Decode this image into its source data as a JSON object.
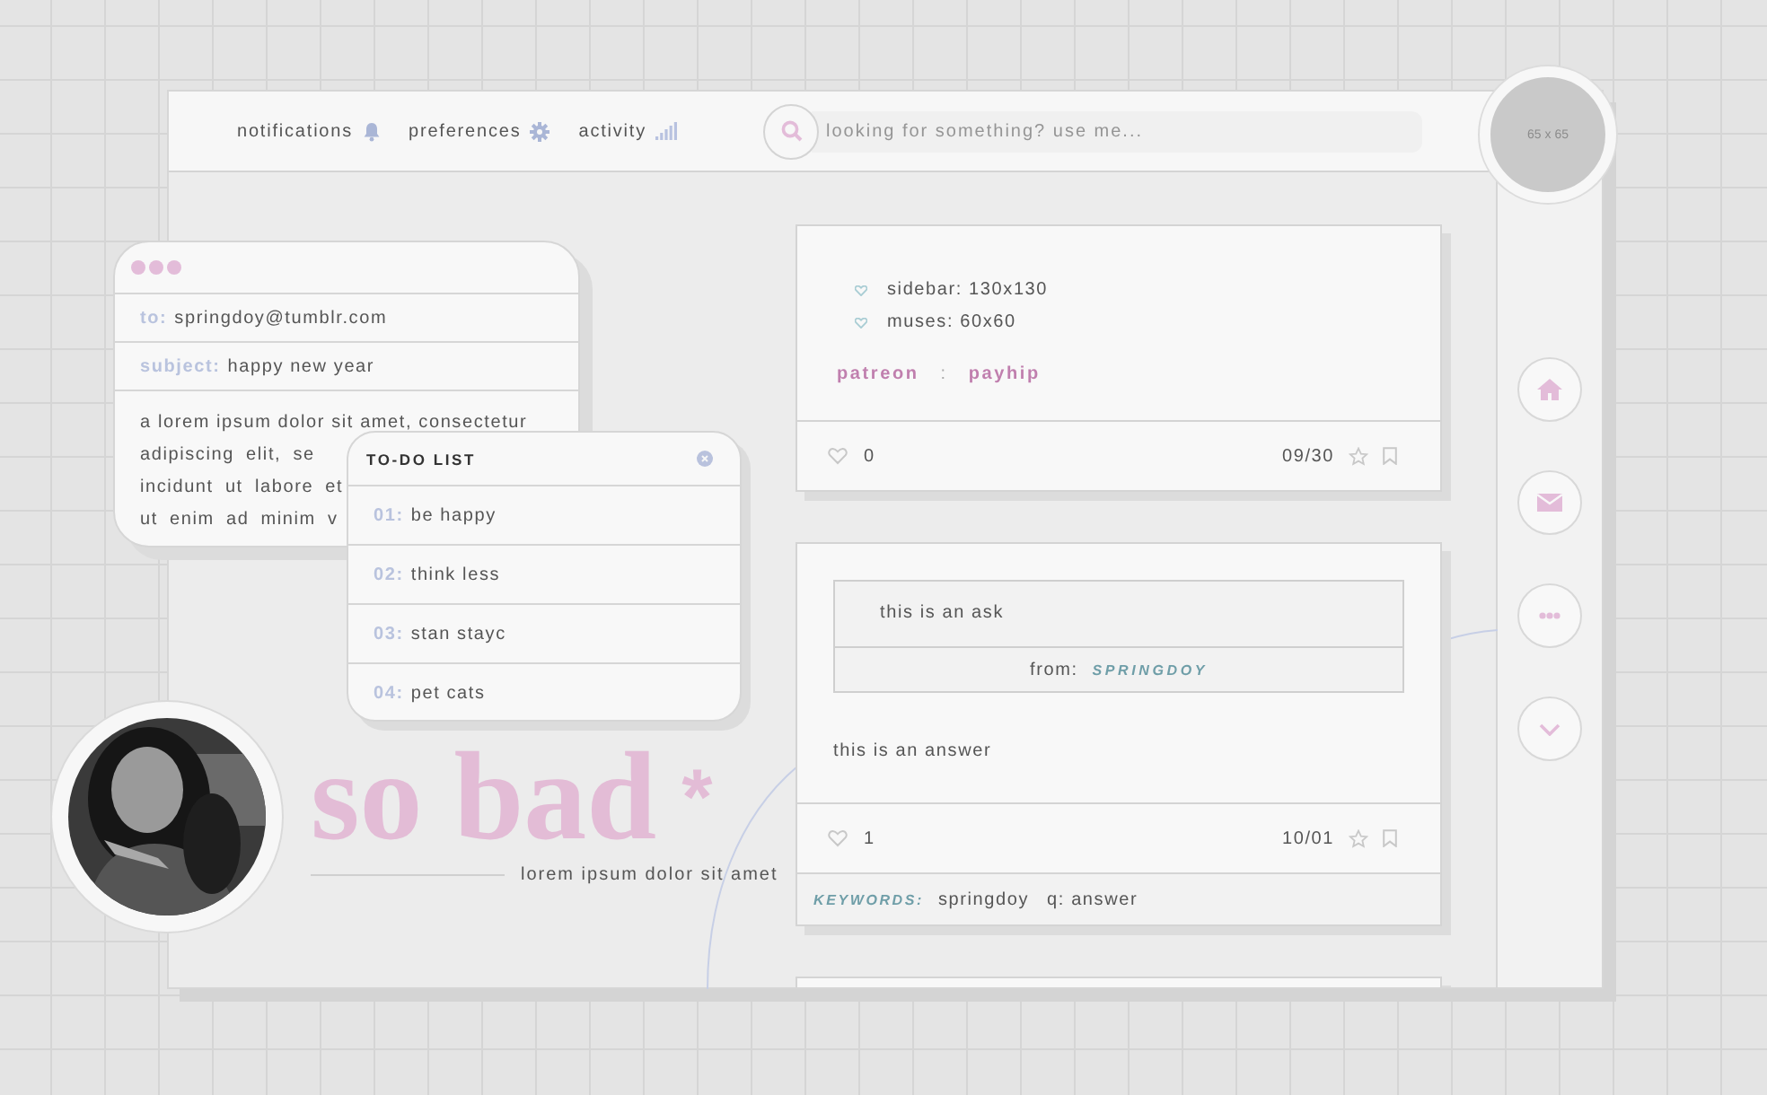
{
  "nav": [
    {
      "label": "notifications"
    },
    {
      "label": "preferences"
    },
    {
      "label": "activity"
    }
  ],
  "search": {
    "placeholder": "looking for something? use me..."
  },
  "avatar": {
    "label": "65 x 65"
  },
  "email": {
    "to_label": "to:",
    "to": "springdoy@tumblr.com",
    "subject_label": "subject:",
    "subject": "happy new year",
    "body_lines": [
      "a lorem ipsum dolor sit amet, consectetur",
      "adipiscing elit, se",
      "incidunt ut labore et",
      "ut enim ad minim v"
    ]
  },
  "todo": {
    "title": "TO-DO LIST",
    "items": [
      {
        "num": "01:",
        "text": "be happy"
      },
      {
        "num": "02:",
        "text": "think less"
      },
      {
        "num": "03:",
        "text": "stan stayc"
      },
      {
        "num": "04:",
        "text": "pet cats"
      }
    ]
  },
  "title": {
    "text": "so bad",
    "mark": "*",
    "subtitle": "lorem ipsum dolor sit amet"
  },
  "posts": [
    {
      "kind": "text",
      "list": [
        "sidebar: 130x130",
        "muses: 60x60"
      ],
      "links": [
        "patreon",
        "payhip"
      ],
      "separator": ":",
      "likes": "0",
      "date": "09/30"
    },
    {
      "kind": "ask",
      "ask": "this is an ask",
      "from_label": "from:",
      "from": "SPRINGDOY",
      "answer": "this is an answer",
      "likes": "1",
      "date": "10/01",
      "keywords_label": "KEYWORDS:",
      "tags": [
        "springdoy",
        "q: answer"
      ]
    },
    {
      "kind": "cut"
    }
  ]
}
